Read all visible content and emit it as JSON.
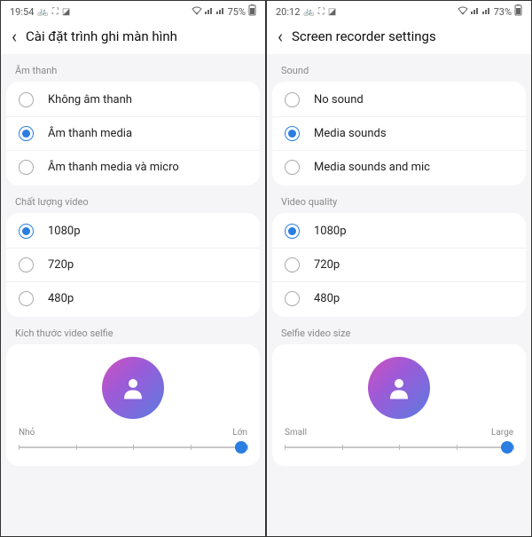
{
  "left": {
    "statusbar": {
      "time": "19:54",
      "battery": "75%"
    },
    "header": {
      "title": "Cài đặt trình ghi màn hình"
    },
    "sound": {
      "label": "Âm thanh",
      "options": [
        {
          "label": "Không âm thanh",
          "selected": false
        },
        {
          "label": "Âm thanh media",
          "selected": true
        },
        {
          "label": "Âm thanh media và micro",
          "selected": false
        }
      ]
    },
    "quality": {
      "label": "Chất lượng video",
      "options": [
        {
          "label": "1080p",
          "selected": true
        },
        {
          "label": "720p",
          "selected": false
        },
        {
          "label": "480p",
          "selected": false
        }
      ]
    },
    "selfie": {
      "label": "Kích thước video selfie",
      "slider": {
        "min_label": "Nhỏ",
        "max_label": "Lớn",
        "value_pct": 100
      }
    }
  },
  "right": {
    "statusbar": {
      "time": "20:12",
      "battery": "73%"
    },
    "header": {
      "title": "Screen recorder settings"
    },
    "sound": {
      "label": "Sound",
      "options": [
        {
          "label": "No sound",
          "selected": false
        },
        {
          "label": "Media sounds",
          "selected": true
        },
        {
          "label": "Media sounds and mic",
          "selected": false
        }
      ]
    },
    "quality": {
      "label": "Video quality",
      "options": [
        {
          "label": "1080p",
          "selected": true
        },
        {
          "label": "720p",
          "selected": false
        },
        {
          "label": "480p",
          "selected": false
        }
      ]
    },
    "selfie": {
      "label": "Selfie video size",
      "slider": {
        "min_label": "Small",
        "max_label": "Large",
        "value_pct": 100
      }
    }
  }
}
